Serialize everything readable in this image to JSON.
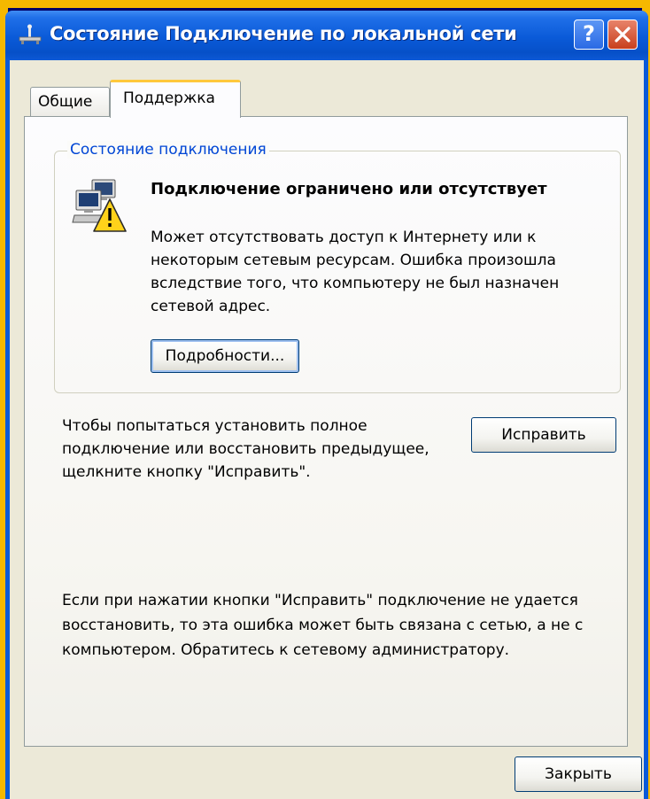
{
  "window": {
    "title": "Состояние Подключение по локальной сети",
    "help_glyph": "?"
  },
  "tabs": [
    {
      "label": "Общие",
      "active": false
    },
    {
      "label": "Поддержка",
      "active": true
    }
  ],
  "connection_status": {
    "group_title": "Состояние подключения",
    "heading": "Подключение ограничено или отсутствует",
    "description": "Может отсутствовать доступ к Интернету или к некоторым сетевым ресурсам. Ошибка произошла вследствие того, что компьютеру не был назначен сетевой адрес.",
    "details_button": "Подробности..."
  },
  "repair": {
    "instruction": "Чтобы попытаться установить полное подключение или восстановить предыдущее, щелкните кнопку \"Исправить\".",
    "button": "Исправить"
  },
  "info": {
    "text": "Если при нажатии кнопки \"Исправить\" подключение не удается восстановить, то эта ошибка может быть связана с сетью, а не с компьютером.  Обратитесь к сетевому администратору."
  },
  "footer": {
    "close_button": "Закрыть"
  },
  "colors": {
    "title_bar": "#0a5ad8",
    "slide_frame": "#f5b800",
    "group_title": "#0046d5",
    "dialog_face": "#ece9d8",
    "active_tab_accent": "#ffc83c"
  },
  "icons": {
    "title": "network-connection-icon",
    "status": "network-warning-icon",
    "help": "help-icon",
    "close": "close-icon"
  }
}
